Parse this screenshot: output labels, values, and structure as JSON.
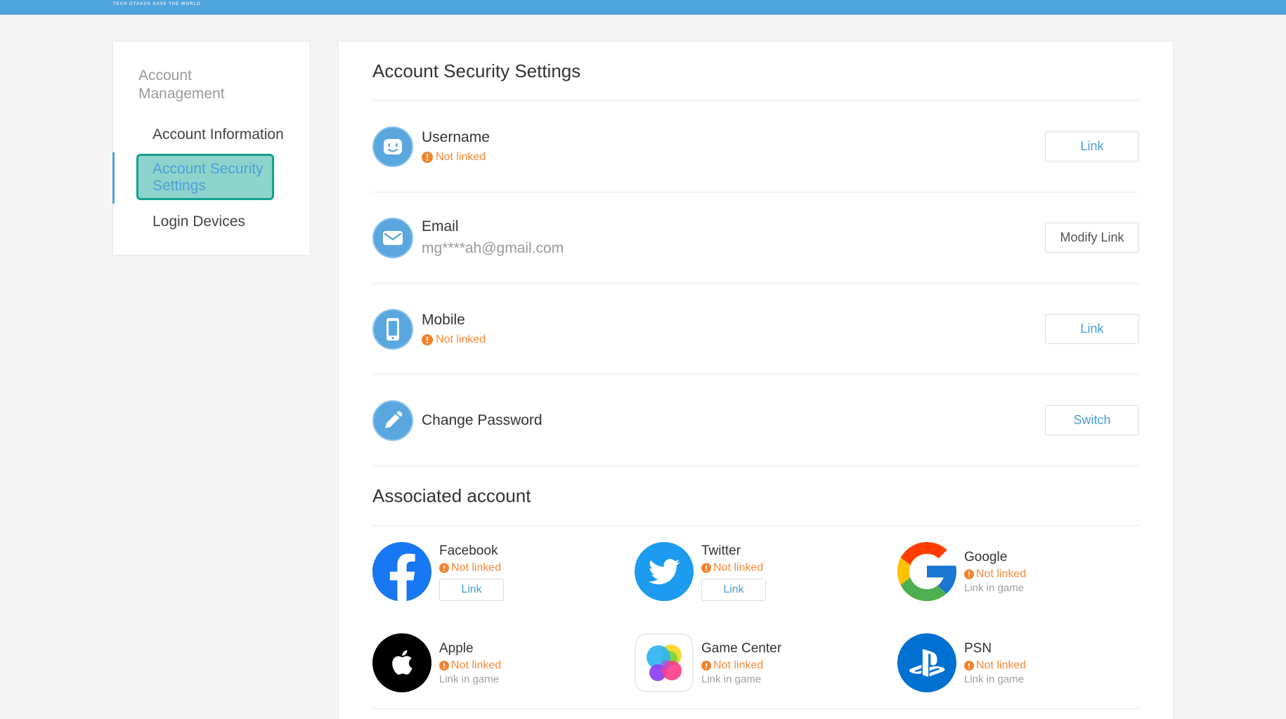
{
  "header": {
    "tagline": "TECH OTAKUS SAVE THE WORLD"
  },
  "sidebar": {
    "section_title": "Account Management",
    "items": [
      {
        "label": "Account Information",
        "active": false
      },
      {
        "label": "Account Security Settings",
        "active": true
      },
      {
        "label": "Login Devices",
        "active": false
      }
    ]
  },
  "security": {
    "title": "Account Security Settings",
    "rows": [
      {
        "name": "Username",
        "status": "Not linked",
        "button": "Link",
        "icon": "robot-face-icon"
      },
      {
        "name": "Email",
        "detail": "mg****ah@gmail.com",
        "button": "Modify Link",
        "icon": "envelope-icon"
      },
      {
        "name": "Mobile",
        "status": "Not linked",
        "button": "Link",
        "icon": "phone-icon"
      },
      {
        "name": "Change Password",
        "button": "Switch",
        "icon": "pencil-icon"
      }
    ]
  },
  "associated": {
    "title": "Associated account",
    "accounts": [
      {
        "name": "Facebook",
        "status": "Not linked",
        "button": "Link",
        "icon": "facebook-icon"
      },
      {
        "name": "Twitter",
        "status": "Not linked",
        "button": "Link",
        "icon": "twitter-icon"
      },
      {
        "name": "Google",
        "status": "Not linked",
        "note": "Link in game",
        "icon": "google-icon"
      },
      {
        "name": "Apple",
        "status": "Not linked",
        "note": "Link in game",
        "icon": "apple-icon"
      },
      {
        "name": "Game Center",
        "status": "Not linked",
        "note": "Link in game",
        "icon": "game-center-icon"
      },
      {
        "name": "PSN",
        "status": "Not linked",
        "note": "Link in game",
        "icon": "playstation-icon"
      }
    ]
  },
  "colors": {
    "topbar": "#4fa4dd",
    "accent": "#4a9fd8",
    "warning": "#f5822a",
    "active_highlight": "#8dd4cc",
    "active_border": "#15a090"
  }
}
